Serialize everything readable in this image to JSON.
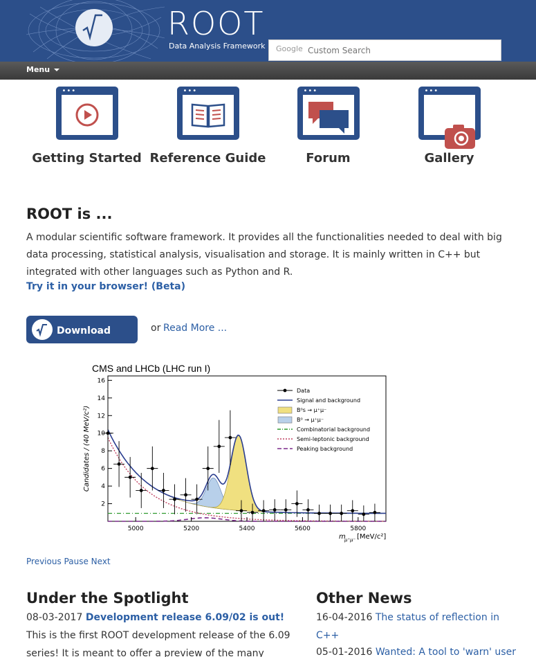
{
  "header": {
    "logo_title": "ROOT",
    "logo_subtitle": "Data Analysis Framework",
    "search_brand": "Google",
    "search_placeholder": "Custom Search"
  },
  "menu": {
    "label": "Menu"
  },
  "tiles": [
    {
      "label": "Getting Started",
      "icon": "play-icon"
    },
    {
      "label": "Reference Guide",
      "icon": "book-icon"
    },
    {
      "label": "Forum",
      "icon": "chat-icon"
    },
    {
      "label": "Gallery",
      "icon": "camera-icon"
    }
  ],
  "intro": {
    "heading": "ROOT is ...",
    "text": "A modular scientific software framework. It provides all the functionalities needed to deal with big data processing, statistical analysis, visualisation and storage. It is mainly written in C++ but integrated with other languages such as Python and R.",
    "try_link": "Try it in your browser! (Beta)",
    "download_label": "Download",
    "or_text": "or",
    "read_more": "Read More ..."
  },
  "slideshow": {
    "previous": "Previous",
    "pause": "Pause",
    "next": "Next"
  },
  "chart_data": {
    "type": "scatter",
    "title": "CMS and LHCb (LHC run I)",
    "ylabel": "Candidates / (40 MeV/c²)",
    "xlabel": "[MeV/c²]",
    "xlabel_symbol": "m",
    "xlabel_subscript": "μ⁺μ⁻",
    "xlim": [
      4900,
      5900
    ],
    "ylim": [
      0,
      16.5
    ],
    "xticks": [
      5000,
      5200,
      5400,
      5600,
      5800
    ],
    "yticks": [
      2,
      4,
      6,
      8,
      10,
      12,
      14,
      16
    ],
    "legend": [
      {
        "label": "Data",
        "style": "marker",
        "color": "#000000"
      },
      {
        "label": "Signal and background",
        "style": "line",
        "color": "#2a3d8f"
      },
      {
        "label": "B⁰s → μ⁺μ⁻",
        "style": "fill",
        "color": "#f0e080"
      },
      {
        "label": "B⁰ → μ⁺μ⁻",
        "style": "fill",
        "color": "#b8d0ea"
      },
      {
        "label": "Combinatorial background",
        "style": "dashdot",
        "color": "#2e9a2e"
      },
      {
        "label": "Semi-leptonic background",
        "style": "dotted",
        "color": "#c04060"
      },
      {
        "label": "Peaking background",
        "style": "dashed",
        "color": "#7a2a8a"
      }
    ],
    "legend_position": "top-right",
    "series": [
      {
        "name": "Data",
        "x": [
          4900,
          4940,
          4980,
          5020,
          5060,
          5100,
          5140,
          5180,
          5220,
          5260,
          5300,
          5340,
          5380,
          5420,
          5460,
          5500,
          5540,
          5580,
          5620,
          5660,
          5700,
          5740,
          5780,
          5820,
          5860
        ],
        "y": [
          10,
          6.5,
          5,
          3.5,
          6,
          3.5,
          2.5,
          3,
          2.5,
          6,
          8.5,
          9.5,
          1.2,
          1,
          1.2,
          1.3,
          1.3,
          2,
          1.3,
          0.9,
          0.9,
          0.9,
          1.2,
          0.8,
          1
        ],
        "y_err": [
          3.2,
          2.6,
          2.3,
          2,
          2.5,
          2,
          1.7,
          1.9,
          1.7,
          2.5,
          3,
          3.1,
          1.2,
          1,
          1.2,
          1.2,
          1.2,
          1.5,
          1.2,
          1,
          1,
          1,
          1.2,
          1,
          1
        ]
      }
    ]
  },
  "spotlight": {
    "heading": "Under the Spotlight",
    "date": "08-03-2017",
    "title": "Development release 6.09/02 is out!",
    "text_line1": "This is the first ROOT development release of the 6.09",
    "text_line2": "series! It is meant to offer a preview of the many features"
  },
  "news": {
    "heading": "Other News",
    "items": [
      {
        "date": "16-04-2016",
        "title": "The status of reflection in",
        "title2": "C++"
      },
      {
        "date": "05-01-2016",
        "title": "Wanted: A tool to 'warn' user"
      }
    ]
  }
}
